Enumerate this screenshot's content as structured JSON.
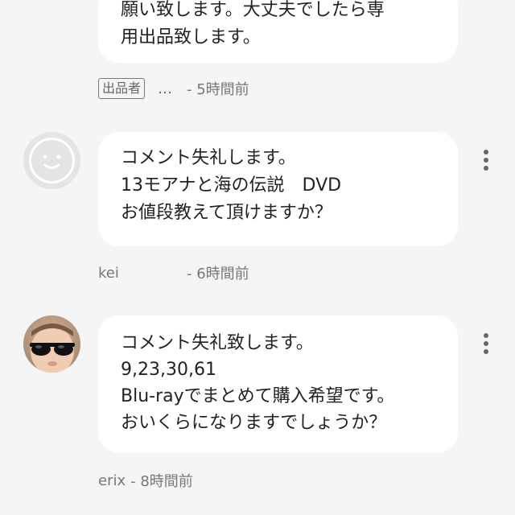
{
  "comments": [
    {
      "lines": [
        "願い致します。大丈夫でしたら専",
        "用出品致します。"
      ],
      "badge": "出品者",
      "author": "…",
      "time": "- 5時間前"
    },
    {
      "avatar_icon": "smiley-face-icon",
      "lines": [
        "コメント失礼します。",
        "13モアナと海の伝説　DVD",
        "お値段教えて頂けますか？"
      ],
      "author": "kei",
      "time": "- 6時間前"
    },
    {
      "avatar_icon": "baby-sunglasses-photo",
      "lines": [
        "コメント失礼致します。",
        "9,23,30,61",
        "Blu-rayでまとめて購入希望です。",
        "おいくらになりますでしょうか？"
      ],
      "author": "erix",
      "time": "- 8時間前"
    }
  ],
  "colors": {
    "background": "#f5f5f5",
    "bubble": "#ffffff",
    "text": "#222222",
    "meta": "#777777"
  }
}
